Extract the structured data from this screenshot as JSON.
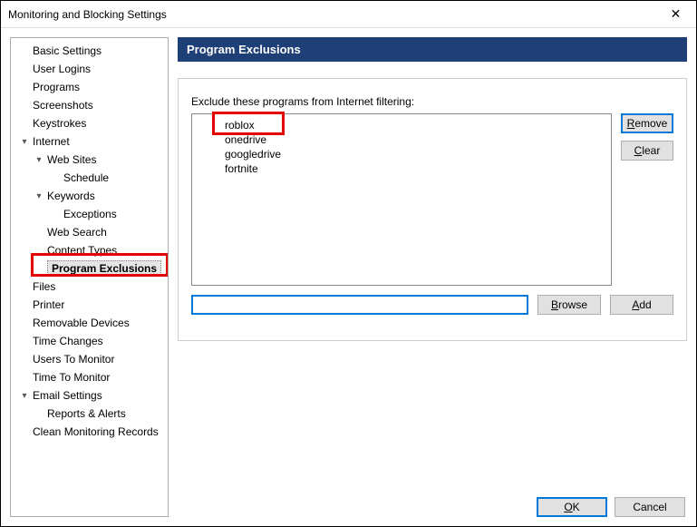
{
  "window": {
    "title": "Monitoring and Blocking Settings",
    "close_glyph": "✕"
  },
  "sidebar": {
    "items": {
      "basic": "Basic Settings",
      "logins": "User Logins",
      "programs": "Programs",
      "screenshots": "Screenshots",
      "keystrokes": "Keystrokes",
      "internet": "Internet",
      "websites": "Web Sites",
      "schedule": "Schedule",
      "keywords": "Keywords",
      "exceptions": "Exceptions",
      "websearch": "Web Search",
      "contenttypes": "Content Types",
      "progexcl": "Program Exclusions",
      "files": "Files",
      "printer": "Printer",
      "remdev": "Removable Devices",
      "timech": "Time Changes",
      "userstomon": "Users To Monitor",
      "timetomon": "Time To Monitor",
      "email": "Email Settings",
      "reports": "Reports & Alerts",
      "clean": "Clean Monitoring Records"
    }
  },
  "main": {
    "header": "Program Exclusions",
    "group_label": "Exclude these programs from Internet filtering:",
    "list": [
      "roblox",
      "onedrive",
      "googledrive",
      "fortnite"
    ],
    "input_value": "",
    "buttons": {
      "remove_u": "R",
      "remove_rest": "emove",
      "clear_u": "C",
      "clear_rest": "lear",
      "browse_u": "B",
      "browse_rest": "rowse",
      "add_u": "A",
      "add_rest": "dd"
    }
  },
  "footer": {
    "ok_u": "O",
    "ok_rest": "K",
    "cancel": "Cancel"
  }
}
